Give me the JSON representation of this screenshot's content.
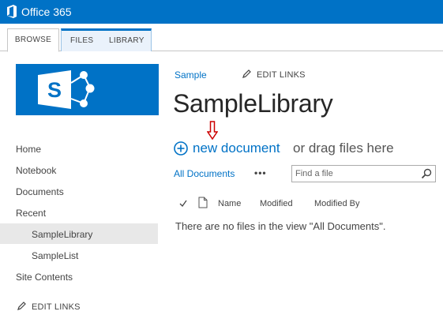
{
  "topbar": {
    "brand": "Office 365"
  },
  "ribbon": {
    "tabs": [
      "BROWSE",
      "FILES",
      "LIBRARY"
    ]
  },
  "nav": {
    "items": [
      "Home",
      "Notebook",
      "Documents",
      "Recent",
      "SampleLibrary",
      "SampleList",
      "Site Contents"
    ],
    "edit_links": "EDIT LINKS"
  },
  "header": {
    "breadcrumb": "Sample",
    "edit_links": "EDIT LINKS",
    "title": "SampleLibrary"
  },
  "library": {
    "new_document": "new document",
    "drag_text": "or drag files here",
    "view_name": "All Documents",
    "more": "•••",
    "search_placeholder": "Find a file",
    "columns": [
      "Name",
      "Modified",
      "Modified By"
    ],
    "empty_message": "There are no files in the view \"All Documents\"."
  },
  "colors": {
    "brand": "#0072c6",
    "annotation_arrow": "#cc0000"
  }
}
